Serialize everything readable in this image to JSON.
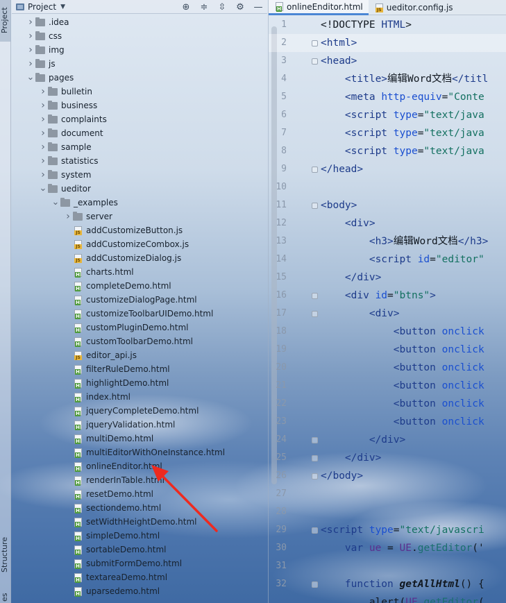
{
  "side_strip": {
    "project_tab": "Project",
    "structure_tab": "Structure",
    "bottom_tab": "es"
  },
  "project_panel": {
    "title": "Project",
    "header_icons": [
      "target-icon",
      "expand-all-icon",
      "collapse-all-icon",
      "gear-icon",
      "minimize-icon"
    ],
    "tree": [
      {
        "label": ".idea",
        "type": "folder",
        "depth": 0,
        "expanded": false
      },
      {
        "label": "css",
        "type": "folder",
        "depth": 0,
        "expanded": false
      },
      {
        "label": "img",
        "type": "folder",
        "depth": 0,
        "expanded": false
      },
      {
        "label": "js",
        "type": "folder",
        "depth": 0,
        "expanded": false
      },
      {
        "label": "pages",
        "type": "folder",
        "depth": 0,
        "expanded": true
      },
      {
        "label": "bulletin",
        "type": "folder",
        "depth": 1,
        "expanded": false
      },
      {
        "label": "business",
        "type": "folder",
        "depth": 1,
        "expanded": false
      },
      {
        "label": "complaints",
        "type": "folder",
        "depth": 1,
        "expanded": false
      },
      {
        "label": "document",
        "type": "folder",
        "depth": 1,
        "expanded": false
      },
      {
        "label": "sample",
        "type": "folder",
        "depth": 1,
        "expanded": false
      },
      {
        "label": "statistics",
        "type": "folder",
        "depth": 1,
        "expanded": false
      },
      {
        "label": "system",
        "type": "folder",
        "depth": 1,
        "expanded": false
      },
      {
        "label": "ueditor",
        "type": "folder",
        "depth": 1,
        "expanded": true
      },
      {
        "label": "_examples",
        "type": "folder",
        "depth": 2,
        "expanded": true
      },
      {
        "label": "server",
        "type": "folder",
        "depth": 3,
        "expanded": false
      },
      {
        "label": "addCustomizeButton.js",
        "type": "js",
        "depth": 3
      },
      {
        "label": "addCustomizeCombox.js",
        "type": "js",
        "depth": 3
      },
      {
        "label": "addCustomizeDialog.js",
        "type": "js",
        "depth": 3
      },
      {
        "label": "charts.html",
        "type": "html",
        "depth": 3
      },
      {
        "label": "completeDemo.html",
        "type": "html",
        "depth": 3
      },
      {
        "label": "customizeDialogPage.html",
        "type": "html",
        "depth": 3
      },
      {
        "label": "customizeToolbarUIDemo.html",
        "type": "html",
        "depth": 3
      },
      {
        "label": "customPluginDemo.html",
        "type": "html",
        "depth": 3
      },
      {
        "label": "customToolbarDemo.html",
        "type": "html",
        "depth": 3
      },
      {
        "label": "editor_api.js",
        "type": "js",
        "depth": 3
      },
      {
        "label": "filterRuleDemo.html",
        "type": "html",
        "depth": 3
      },
      {
        "label": "highlightDemo.html",
        "type": "html",
        "depth": 3
      },
      {
        "label": "index.html",
        "type": "html",
        "depth": 3
      },
      {
        "label": "jqueryCompleteDemo.html",
        "type": "html",
        "depth": 3
      },
      {
        "label": "jqueryValidation.html",
        "type": "html",
        "depth": 3
      },
      {
        "label": "multiDemo.html",
        "type": "html",
        "depth": 3
      },
      {
        "label": "multiEditorWithOneInstance.html",
        "type": "html",
        "depth": 3
      },
      {
        "label": "onlineEnditor.html",
        "type": "html",
        "depth": 3
      },
      {
        "label": "renderInTable.html",
        "type": "html",
        "depth": 3
      },
      {
        "label": "resetDemo.html",
        "type": "html",
        "depth": 3
      },
      {
        "label": "sectiondemo.html",
        "type": "html",
        "depth": 3
      },
      {
        "label": "setWidthHeightDemo.html",
        "type": "html",
        "depth": 3
      },
      {
        "label": "simpleDemo.html",
        "type": "html",
        "depth": 3
      },
      {
        "label": "sortableDemo.html",
        "type": "html",
        "depth": 3
      },
      {
        "label": "submitFormDemo.html",
        "type": "html",
        "depth": 3
      },
      {
        "label": "textareaDemo.html",
        "type": "html",
        "depth": 3
      },
      {
        "label": "uparsedemo.html",
        "type": "html",
        "depth": 3
      }
    ]
  },
  "editor": {
    "tabs": [
      {
        "label": "onlineEnditor.html",
        "type": "html",
        "active": true
      },
      {
        "label": "ueditor.config.js",
        "type": "js",
        "active": false
      }
    ],
    "line_numbers": [
      "1",
      "2",
      "3",
      "4",
      "5",
      "6",
      "7",
      "8",
      "9",
      "10",
      "11",
      "12",
      "13",
      "14",
      "15",
      "16",
      "17",
      "18",
      "19",
      "20",
      "21",
      "22",
      "23",
      "24",
      "25",
      "26",
      "27",
      "28",
      "29",
      "30",
      "31",
      "32"
    ],
    "lines": [
      [
        [
          "plain",
          "<!DOCTYPE "
        ],
        [
          "tag",
          "HTML"
        ],
        [
          "plain",
          ">"
        ]
      ],
      [
        [
          "tag",
          "<html>"
        ]
      ],
      [
        [
          "tag",
          "<head>"
        ]
      ],
      [
        [
          "plain",
          "    "
        ],
        [
          "tag",
          "<title>"
        ],
        [
          "plain",
          "编辑Word文档"
        ],
        [
          "tag",
          "</titl"
        ]
      ],
      [
        [
          "plain",
          "    "
        ],
        [
          "tag",
          "<meta "
        ],
        [
          "attr",
          "http-equiv"
        ],
        [
          "plain",
          "="
        ],
        [
          "str",
          "\"Conte"
        ]
      ],
      [
        [
          "plain",
          "    "
        ],
        [
          "tag",
          "<script "
        ],
        [
          "attr",
          "type"
        ],
        [
          "plain",
          "="
        ],
        [
          "str",
          "\"text/java"
        ]
      ],
      [
        [
          "plain",
          "    "
        ],
        [
          "tag",
          "<script "
        ],
        [
          "attr",
          "type"
        ],
        [
          "plain",
          "="
        ],
        [
          "str",
          "\"text/java"
        ]
      ],
      [
        [
          "plain",
          "    "
        ],
        [
          "tag",
          "<script "
        ],
        [
          "attr",
          "type"
        ],
        [
          "plain",
          "="
        ],
        [
          "str",
          "\"text/java"
        ]
      ],
      [
        [
          "tag",
          "</head>"
        ]
      ],
      [],
      [
        [
          "tag",
          "<body>"
        ]
      ],
      [
        [
          "plain",
          "    "
        ],
        [
          "tag",
          "<div>"
        ]
      ],
      [
        [
          "plain",
          "        "
        ],
        [
          "tag",
          "<h3>"
        ],
        [
          "plain",
          "编辑Word文档"
        ],
        [
          "tag",
          "</h3>"
        ]
      ],
      [
        [
          "plain",
          "        "
        ],
        [
          "tag",
          "<script "
        ],
        [
          "attr",
          "id"
        ],
        [
          "plain",
          "="
        ],
        [
          "str",
          "\"editor\""
        ]
      ],
      [
        [
          "plain",
          "    "
        ],
        [
          "tag",
          "</div>"
        ]
      ],
      [
        [
          "plain",
          "    "
        ],
        [
          "tag",
          "<div "
        ],
        [
          "attr",
          "id"
        ],
        [
          "plain",
          "="
        ],
        [
          "str",
          "\"btns\""
        ],
        [
          "tag",
          ">"
        ]
      ],
      [
        [
          "plain",
          "        "
        ],
        [
          "tag",
          "<div>"
        ]
      ],
      [
        [
          "plain",
          "            "
        ],
        [
          "tag",
          "<button "
        ],
        [
          "attr",
          "onclick"
        ]
      ],
      [
        [
          "plain",
          "            "
        ],
        [
          "tag",
          "<button "
        ],
        [
          "attr",
          "onclick"
        ]
      ],
      [
        [
          "plain",
          "            "
        ],
        [
          "tag",
          "<button "
        ],
        [
          "attr",
          "onclick"
        ]
      ],
      [
        [
          "plain",
          "            "
        ],
        [
          "tag",
          "<button "
        ],
        [
          "attr",
          "onclick"
        ]
      ],
      [
        [
          "plain",
          "            "
        ],
        [
          "tag",
          "<button "
        ],
        [
          "attr",
          "onclick"
        ]
      ],
      [
        [
          "plain",
          "            "
        ],
        [
          "tag",
          "<button "
        ],
        [
          "attr",
          "onclick"
        ]
      ],
      [
        [
          "plain",
          "        "
        ],
        [
          "tag",
          "</div>"
        ]
      ],
      [
        [
          "plain",
          "    "
        ],
        [
          "tag",
          "</div>"
        ]
      ],
      [
        [
          "tag",
          "</body>"
        ]
      ],
      [],
      [],
      [
        [
          "tag",
          "<script "
        ],
        [
          "attr",
          "type"
        ],
        [
          "plain",
          "="
        ],
        [
          "str",
          "\"text/javascri"
        ]
      ],
      [
        [
          "plain",
          "    "
        ],
        [
          "kw",
          "var "
        ],
        [
          "var",
          "ue"
        ],
        [
          "plain",
          " = "
        ],
        [
          "var",
          "UE"
        ],
        [
          "plain",
          "."
        ],
        [
          "meth",
          "getEditor"
        ],
        [
          "plain",
          "('"
        ]
      ],
      [],
      [
        [
          "plain",
          "    "
        ],
        [
          "kw",
          "function "
        ],
        [
          "fn",
          "getAllHtml"
        ],
        [
          "plain",
          "() {"
        ]
      ],
      [
        [
          "plain",
          "        "
        ],
        [
          "plain",
          "alert("
        ],
        [
          "var",
          "UE"
        ],
        [
          "plain",
          "."
        ],
        [
          "meth",
          "getEditor"
        ],
        [
          "plain",
          "("
        ]
      ]
    ]
  }
}
